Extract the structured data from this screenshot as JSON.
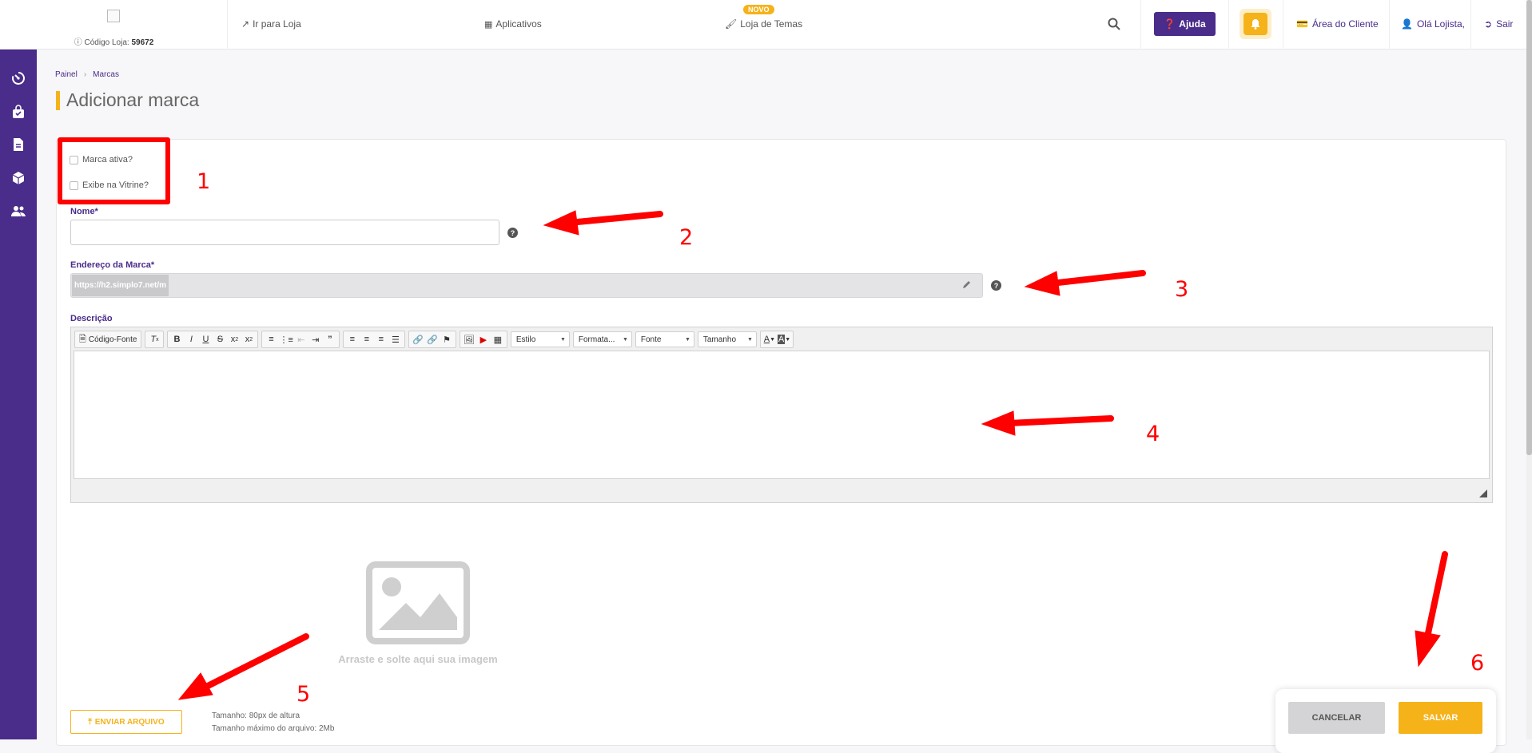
{
  "header": {
    "store_code_label": "Código Loja:",
    "store_code_value": "59672",
    "nav_store": "Ir para Loja",
    "nav_apps": "Aplicativos",
    "nav_themes": "Loja de Temas",
    "novo_badge": "NOVO",
    "help": "Ajuda",
    "client_area": "Área do Cliente",
    "greeting": "Olá Lojista,",
    "logout": "Sair"
  },
  "breadcrumb": {
    "home": "Painel",
    "current": "Marcas"
  },
  "page_title": "Adicionar marca",
  "form": {
    "active_label": "Marca ativa?",
    "showcase_label": "Exibe na Vitrine?",
    "name_label": "Nome*",
    "url_label": "Endereço da Marca*",
    "url_prefix": "https://h2.simplo7.net/m",
    "description_label": "Descrição"
  },
  "editor": {
    "source_label": "Código-Fonte",
    "combo_style": "Estilo",
    "combo_format": "Formata...",
    "combo_font": "Fonte",
    "combo_size": "Tamanho"
  },
  "upload": {
    "drop_text": "Arraste e solte aqui sua imagem",
    "button_label": "ENVIAR ARQUIVO",
    "size_info": "Tamanho: 80px de altura",
    "max_info": "Tamanho máximo do arquivo: 2Mb"
  },
  "actions": {
    "cancel": "CANCELAR",
    "save": "SALVAR"
  },
  "annotations": [
    "1",
    "2",
    "3",
    "4",
    "5",
    "6"
  ],
  "colors": {
    "brand_purple": "#4a2c8a",
    "accent_yellow": "#f5b219",
    "annotation_red": "#ff0000"
  }
}
